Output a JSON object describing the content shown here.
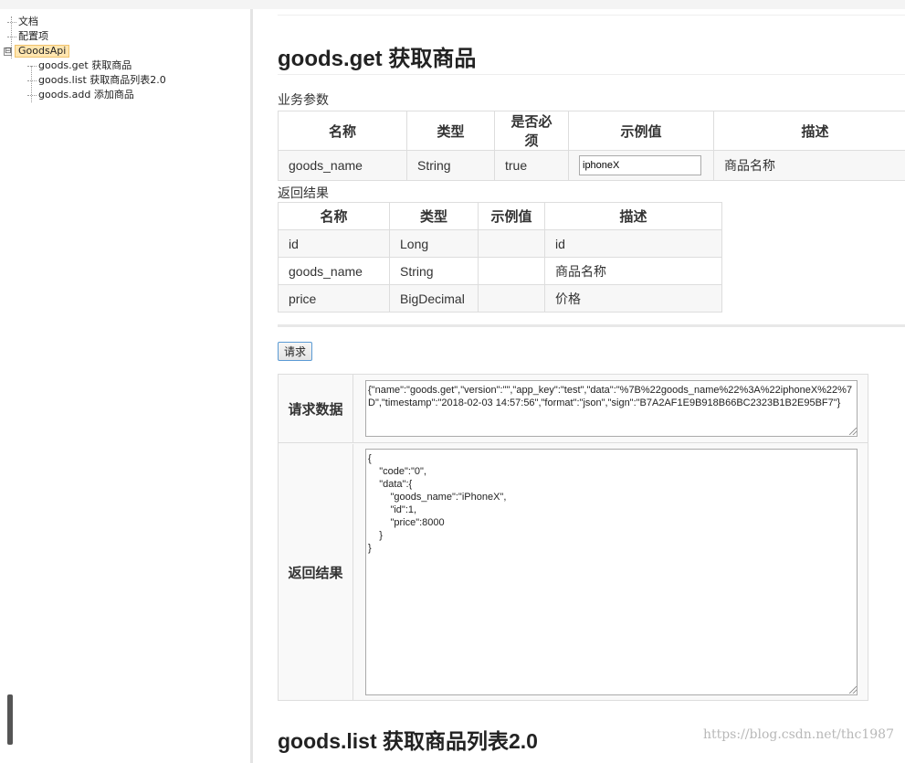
{
  "sidebar": {
    "items": [
      "文档",
      "配置项"
    ],
    "root": {
      "expander": "⊟",
      "label": "GoodsApi",
      "children": [
        "goods.get 获取商品",
        "goods.list 获取商品列表2.0",
        "goods.add 添加商品"
      ]
    }
  },
  "main": {
    "title": "goods.get 获取商品",
    "biz_params": {
      "label": "业务参数",
      "headers": [
        "名称",
        "类型",
        "是否必须",
        "示例值",
        "描述"
      ],
      "rows": [
        {
          "name": "goods_name",
          "type": "String",
          "required": "true",
          "example": "iphoneX",
          "desc": "商品名称"
        }
      ]
    },
    "return_result": {
      "label": "返回结果",
      "headers": [
        "名称",
        "类型",
        "示例值",
        "描述"
      ],
      "rows": [
        {
          "name": "id",
          "type": "Long",
          "example": "",
          "desc": "id"
        },
        {
          "name": "goods_name",
          "type": "String",
          "example": "",
          "desc": "商品名称"
        },
        {
          "name": "price",
          "type": "BigDecimal",
          "example": "",
          "desc": "价格"
        }
      ]
    },
    "request_button": "请求",
    "request_data_label": "请求数据",
    "request_data": "{\"name\":\"goods.get\",\"version\":\"\",\"app_key\":\"test\",\"data\":\"%7B%22goods_name%22%3A%22iphoneX%22%7D\",\"timestamp\":\"2018-02-03 14:57:56\",\"format\":\"json\",\"sign\":\"B7A2AF1E9B918B66BC2323B1B2E95BF7\"}",
    "response_label": "返回结果",
    "response_data": "{\n    \"code\":\"0\",\n    \"data\":{\n        \"goods_name\":\"iPhoneX\",\n        \"id\":1,\n        \"price\":8000\n    }\n}",
    "next_title": "goods.list 获取商品列表2.0"
  },
  "watermark": "https://blog.csdn.net/thc1987"
}
